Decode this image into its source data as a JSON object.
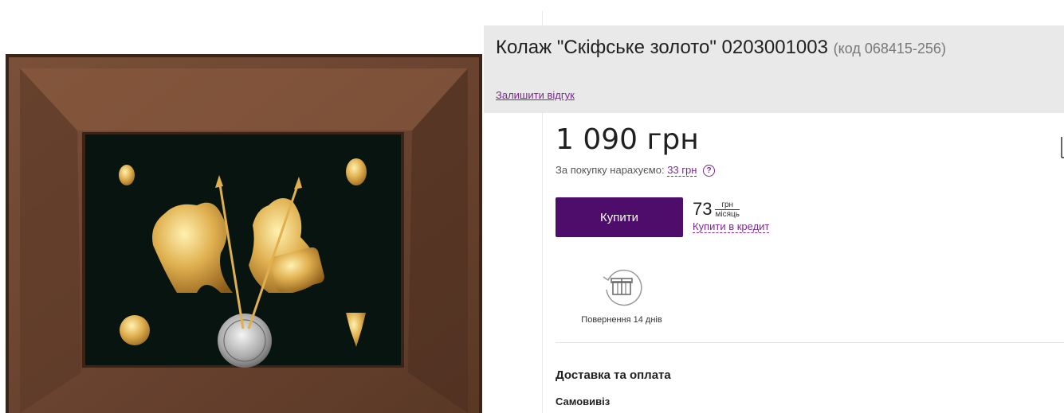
{
  "product": {
    "title": "Колаж \"Скіфське золото\" 0203001003",
    "code": "(код 068415-256)",
    "review_link": "Залишити відгук",
    "image_alt": "Колаж Скіфське золото"
  },
  "price": {
    "value": "1 090 грн",
    "bonus_prefix": "За покупку нарахуємо:",
    "bonus_amount": "33 грн",
    "help_icon": "?"
  },
  "actions": {
    "buy_label": "Купити",
    "credit_amount": "73",
    "credit_unit_top": "грн",
    "credit_unit_bottom": "місяць",
    "credit_link": "Купити в кредит"
  },
  "return_policy": {
    "icon": "gift-return-icon",
    "label": "Повернення 14 днів"
  },
  "delivery": {
    "title": "Доставка та оплата",
    "method": "Самовивіз"
  },
  "colors": {
    "accent": "#7c2795",
    "buy_button": "#4e0c6b",
    "title_bar": "#e9e9e9",
    "frame": "#6e4630",
    "velvet": "#071410",
    "gold": "#d6a84a"
  }
}
